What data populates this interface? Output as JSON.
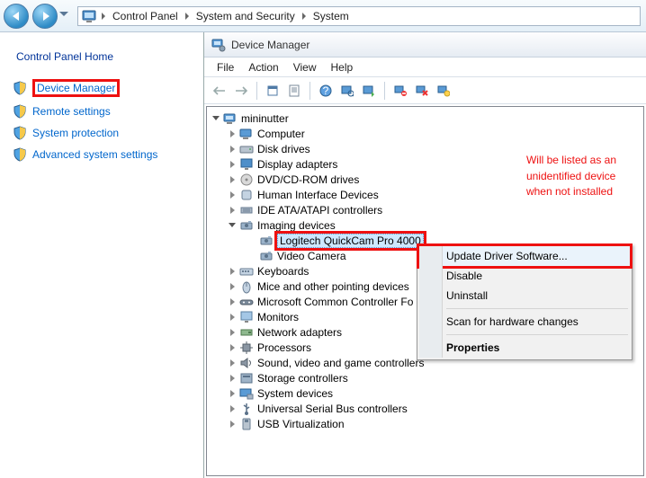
{
  "breadcrumb": {
    "seg1": "Control Panel",
    "seg2": "System and Security",
    "seg3": "System"
  },
  "leftpane": {
    "home": "Control Panel Home",
    "links": [
      "Device Manager",
      "Remote settings",
      "System protection",
      "Advanced system settings"
    ]
  },
  "dm": {
    "title": "Device Manager",
    "menu": {
      "file": "File",
      "action": "Action",
      "view": "View",
      "help": "Help"
    },
    "root": "mininutter",
    "categories": [
      "Computer",
      "Disk drives",
      "Display adapters",
      "DVD/CD-ROM drives",
      "Human Interface Devices",
      "IDE ATA/ATAPI controllers",
      "Imaging devices",
      "Keyboards",
      "Mice and other pointing devices",
      "Microsoft Common Controller Fo",
      "Monitors",
      "Network adapters",
      "Processors",
      "Sound, video and game controllers",
      "Storage controllers",
      "System devices",
      "Universal Serial Bus controllers",
      "USB Virtualization"
    ],
    "imaging_children": [
      "Logitech QuickCam Pro 4000",
      "Video Camera"
    ]
  },
  "annotation": {
    "l1": "Will be listed as an",
    "l2": "unidentified device",
    "l3": "when not installed"
  },
  "ctx": {
    "update": "Update Driver Software...",
    "disable": "Disable",
    "uninstall": "Uninstall",
    "scan": "Scan for hardware changes",
    "properties": "Properties"
  }
}
